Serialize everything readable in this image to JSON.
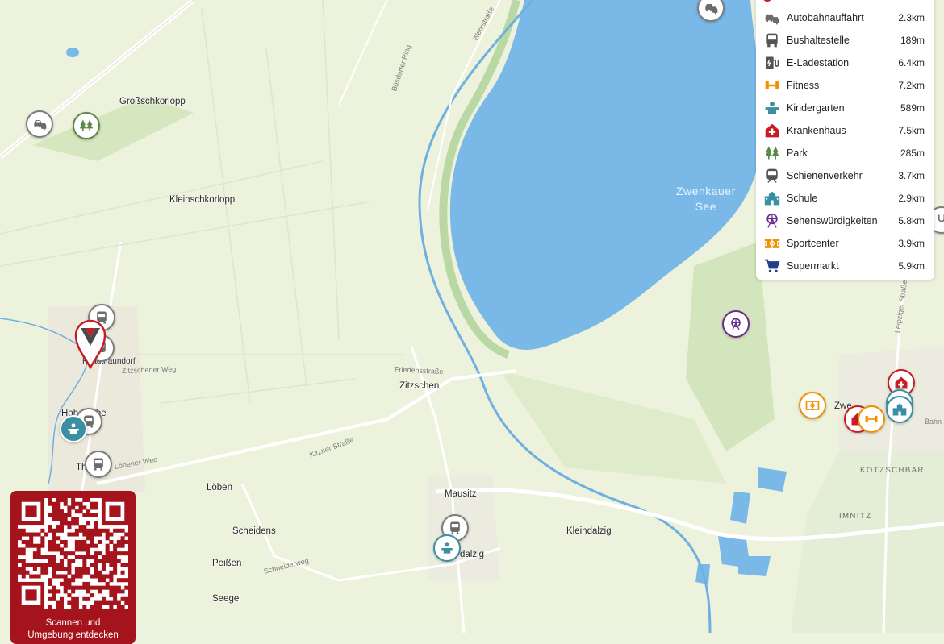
{
  "map": {
    "lake_label": [
      "Zwenkauer",
      "See"
    ],
    "places": [
      {
        "id": "grosskorlopp",
        "label": "Großschkorlopp"
      },
      {
        "id": "kleinschkorlopp",
        "label": "Kleinschkorlopp"
      },
      {
        "id": "knautnaundorf",
        "label": "Knautnaundorf"
      },
      {
        "id": "zitzschen",
        "label": "Zitzschen"
      },
      {
        "id": "hohenlohe",
        "label": "Hohenlohe"
      },
      {
        "id": "thronitz",
        "label": "Th"
      },
      {
        "id": "loeben",
        "label": "Löben"
      },
      {
        "id": "mausitz",
        "label": "Mausitz"
      },
      {
        "id": "scheidens",
        "label": "Scheidens"
      },
      {
        "id": "kleindalzig",
        "label": "Kleindalzig"
      },
      {
        "id": "peissen",
        "label": "Peißen"
      },
      {
        "id": "seegel",
        "label": "Seegel"
      },
      {
        "id": "grossdalzig",
        "label": "dalzig"
      },
      {
        "id": "zwenkau",
        "label": "Zwe"
      }
    ],
    "streets": [
      {
        "id": "werkstrasse",
        "label": "Werkstraße"
      },
      {
        "id": "bosdorfer-ring",
        "label": "Bösdorfer Ring"
      },
      {
        "id": "friedensstrasse",
        "label": "Friedensstraße"
      },
      {
        "id": "zitzschener-weg",
        "label": "Zitzschener Weg"
      },
      {
        "id": "kitzner-strasse",
        "label": "Kitzner Straße"
      },
      {
        "id": "loebener-weg",
        "label": "Löbener Weg"
      },
      {
        "id": "schneiderweg",
        "label": "Schneiderweg"
      },
      {
        "id": "leipziger-strasse",
        "label": "Leipziger Straße"
      },
      {
        "id": "bahn",
        "label": "Bahn"
      }
    ],
    "districts": [
      "KOTZSCHBAR",
      "IMNITZ"
    ]
  },
  "legend": [
    {
      "name": "Autobahnauffahrt",
      "distance": "2.3km",
      "icon": "car-highway-icon",
      "color": "#6b6b6b"
    },
    {
      "name": "Bushaltestelle",
      "distance": "189m",
      "icon": "bus-icon",
      "color": "#6b6b6b"
    },
    {
      "name": "E-Ladestation",
      "distance": "6.4km",
      "icon": "ev-charger-icon",
      "color": "#6b6b6b"
    },
    {
      "name": "Fitness",
      "distance": "7.2km",
      "icon": "dumbbell-icon",
      "color": "#f29100"
    },
    {
      "name": "Kindergarten",
      "distance": "589m",
      "icon": "kindergarten-icon",
      "color": "#3a8fa3"
    },
    {
      "name": "Krankenhaus",
      "distance": "7.5km",
      "icon": "hospital-icon",
      "color": "#c81d25"
    },
    {
      "name": "Park",
      "distance": "285m",
      "icon": "trees-icon",
      "color": "#5b8a4a"
    },
    {
      "name": "Schienenverkehr",
      "distance": "3.7km",
      "icon": "train-icon",
      "color": "#6b6b6b"
    },
    {
      "name": "Schule",
      "distance": "2.9km",
      "icon": "school-icon",
      "color": "#3a8fa3"
    },
    {
      "name": "Sehenswürdigkeiten",
      "distance": "5.8km",
      "icon": "ferris-wheel-icon",
      "color": "#6b2c8e"
    },
    {
      "name": "Sportcenter",
      "distance": "3.9km",
      "icon": "sports-field-icon",
      "color": "#f29100"
    },
    {
      "name": "Supermarkt",
      "distance": "5.9km",
      "icon": "shopping-cart-icon",
      "color": "#1f3f8a"
    }
  ],
  "qr": {
    "caption_line1": "Scannen und",
    "caption_line2": "Umgebung entdecken",
    "brand_color": "#a5141c"
  },
  "colors": {
    "water": "#7ab8e8",
    "land": "#eef3df",
    "road": "#ffffff",
    "rail": "#6fb0e0"
  }
}
